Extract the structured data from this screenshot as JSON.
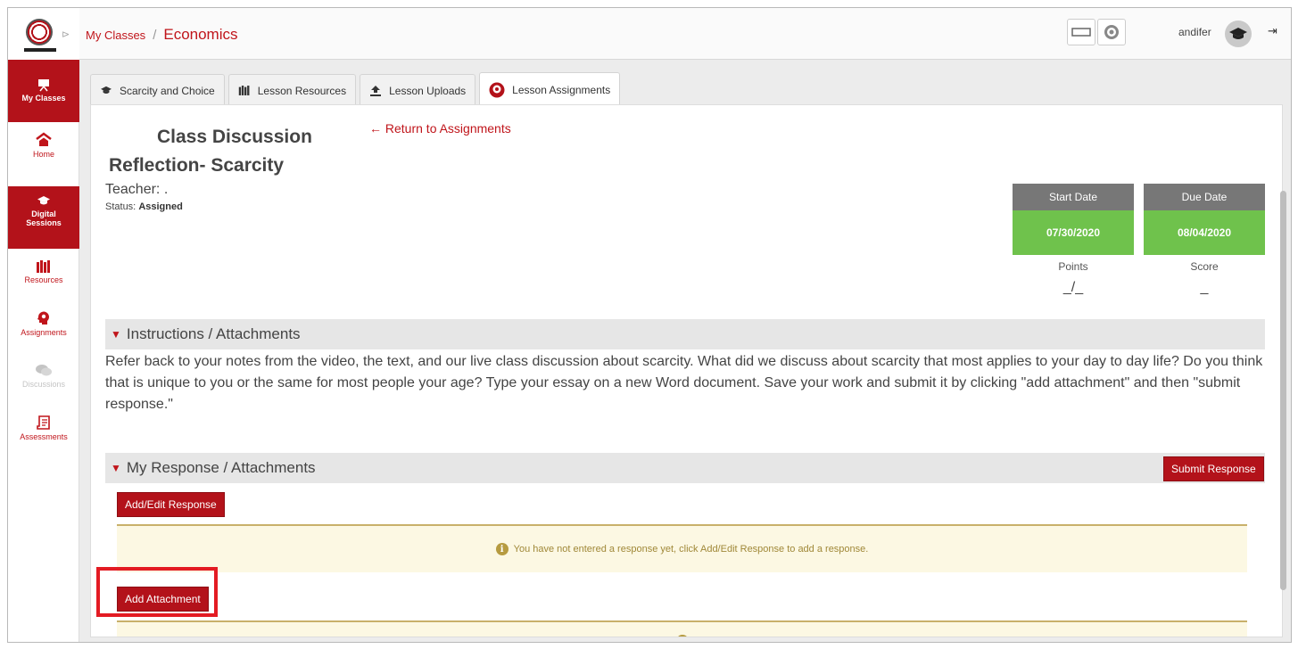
{
  "header": {
    "breadcrumb_root": "My Classes",
    "breadcrumb_separator": "/",
    "class_name": "Economics",
    "user_name": "andifer"
  },
  "sidebar": {
    "items": [
      {
        "label": "My Classes",
        "icon": "presentation-board-icon",
        "state": "active"
      },
      {
        "label": "Home",
        "icon": "home-icon",
        "state": "normal"
      },
      {
        "label": "Digital Sessions",
        "icon": "graduation-cap-icon",
        "state": "active"
      },
      {
        "label": "Resources",
        "icon": "books-icon",
        "state": "normal"
      },
      {
        "label": "Assignments",
        "icon": "head-gears-icon",
        "state": "normal"
      },
      {
        "label": "Discussions",
        "icon": "chat-bubbles-icon",
        "state": "disabled"
      },
      {
        "label": "Assessments",
        "icon": "exam-paper-icon",
        "state": "normal"
      }
    ]
  },
  "tabs": [
    {
      "label": "Scarcity and Choice",
      "icon": "graduation-cap-icon",
      "active": false
    },
    {
      "label": "Lesson Resources",
      "icon": "books-icon",
      "active": false
    },
    {
      "label": "Lesson Uploads",
      "icon": "upload-icon",
      "active": false
    },
    {
      "label": "Lesson Assignments",
      "icon": "head-gears-icon",
      "active": true
    }
  ],
  "assignment": {
    "title_line1": "Class Discussion",
    "title_line2": "Reflection- Scarcity",
    "return_link": "← Return to Assignments",
    "teacher_label": "Teacher: .",
    "status_label": "Status:",
    "status_value": "Assigned",
    "start_date_label": "Start Date",
    "start_date": "07/30/2020",
    "due_date_label": "Due Date",
    "due_date": "08/04/2020",
    "points_label": "Points",
    "points_value": "_/_",
    "score_label": "Score",
    "score_value": "_"
  },
  "instructions": {
    "header": "Instructions / Attachments",
    "text": "Refer back to your notes from the video, the text, and our live class discussion about scarcity.  What did we discuss about scarcity that most applies to your day to day life? Do you think that is unique to you or the same for most people your age? Type your essay on a new Word document. Save your work and submit it by clicking \"add attachment\" and then \"submit response.\""
  },
  "response": {
    "header": "My Response / Attachments",
    "submit_button": "Submit Response",
    "edit_button": "Add/Edit Response",
    "empty_notice": "You have not entered a response yet, click Add/Edit Response to add a response.",
    "attachment_button": "Add Attachment"
  },
  "colors": {
    "brand_red": "#b3121a",
    "date_green": "#6fc24c",
    "date_header_gray": "#777777",
    "notice_bg": "#fcf8e3",
    "highlight_red": "#e31b23"
  }
}
